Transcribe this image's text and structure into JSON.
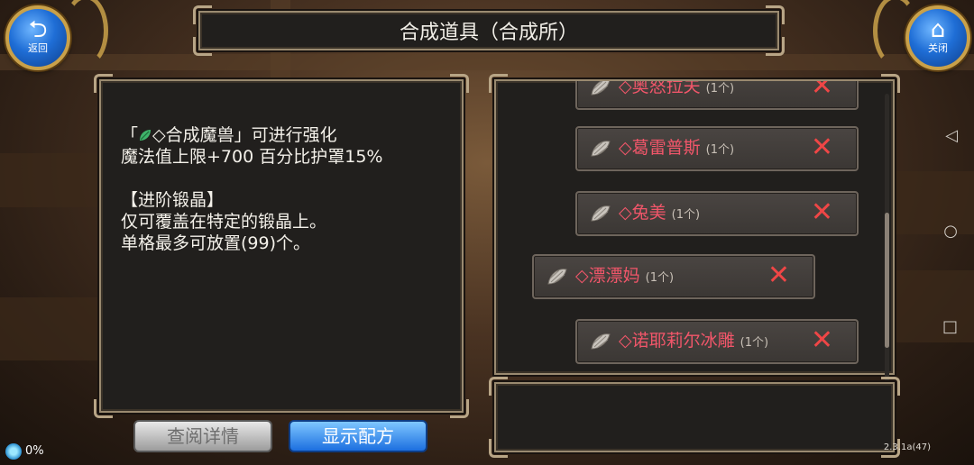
{
  "header": {
    "back_label": "返回",
    "close_label": "关闭",
    "title": "合成道具（合成所）"
  },
  "description": {
    "line1_prefix": "「",
    "line1_item": "◇合成魔兽",
    "line1_suffix": "」可进行强化",
    "line2": "魔法值上限+700 百分比护罩15%",
    "line3": "【进阶锻晶】",
    "line4": "仅可覆盖在特定的锻晶上。",
    "line5": "单格最多可放置(99)个。"
  },
  "list": {
    "items": [
      {
        "name": "◇奥怒拉夫",
        "count": "(1个)"
      },
      {
        "name": "◇葛雷普斯",
        "count": "(1个)"
      },
      {
        "name": "◇兔美",
        "count": "(1个)"
      },
      {
        "name": "◇漂漂妈",
        "count": "(1个)"
      },
      {
        "name": "◇诺耶莉尔冰雕",
        "count": "(1个)"
      }
    ]
  },
  "buttons": {
    "view_details": "查阅详情",
    "show_recipe": "显示配方"
  },
  "status": {
    "progress": "0%",
    "version": "2.3.1a(47)"
  },
  "android_nav": {
    "back": "◁",
    "home": "○",
    "recents": "□"
  },
  "colors": {
    "item_name": "#f2566a",
    "remove_x": "#ef4646",
    "panel_bg": "#211f1d",
    "accent_blue": "#1f6ed6"
  },
  "icons": {
    "back": "return-arrow-icon",
    "close": "home-icon",
    "item": "shell-crystal-icon",
    "remove": "close-x-icon"
  }
}
